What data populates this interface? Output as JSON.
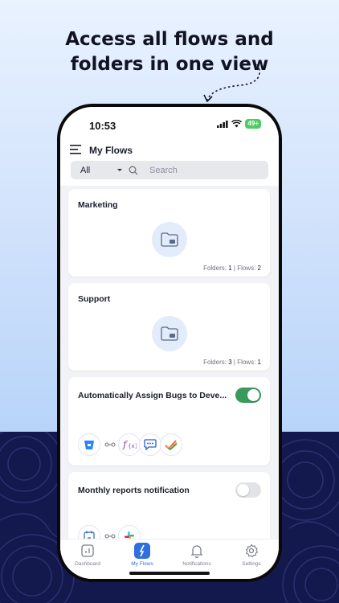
{
  "promo": {
    "headline_line1": "Access all flows and",
    "headline_line2": "folders in one view"
  },
  "status_bar": {
    "time": "10:53",
    "battery": "49+"
  },
  "header": {
    "title": "My Flows",
    "filter_value": "All",
    "search_placeholder": "Search"
  },
  "folders": [
    {
      "name": "Marketing",
      "folders_label": "Folders:",
      "folders_count": "1",
      "separator": "| Flows:",
      "flows_count": "2"
    },
    {
      "name": "Support",
      "folders_label": "Folders:",
      "folders_count": "3",
      "separator": "| Flows:",
      "flows_count": "1"
    }
  ],
  "flows": [
    {
      "name": "Automatically Assign Bugs to Deve...",
      "enabled": true,
      "apps": [
        "bitbucket-icon",
        "function-icon",
        "cliq-icon",
        "projects-icon"
      ]
    },
    {
      "name": "Monthly reports notification",
      "enabled": false,
      "apps": [
        "calendar-icon",
        "slack-icon"
      ]
    }
  ],
  "tabs": [
    {
      "label": "Dashboard",
      "icon": "dashboard-icon",
      "active": false
    },
    {
      "label": "My Flows",
      "icon": "flows-icon",
      "active": true
    },
    {
      "label": "Notifications",
      "icon": "bell-icon",
      "active": false
    },
    {
      "label": "Settings",
      "icon": "gear-icon",
      "active": false
    }
  ],
  "colors": {
    "accent": "#2f6fde",
    "toggle_on": "#3a9a5b",
    "navy": "#14194d"
  }
}
